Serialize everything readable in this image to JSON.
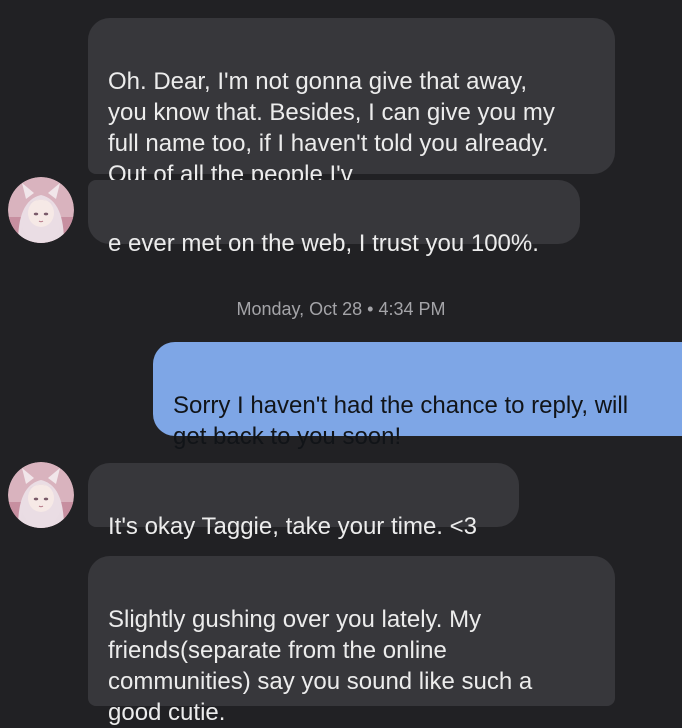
{
  "conversation": {
    "messages": [
      {
        "sender": "contact",
        "text": "Oh. Dear, I'm not gonna give that away,\nyou know that. Besides, I can give you my\nfull name too, if I haven't told you already.\nOut of all the people I'v"
      },
      {
        "sender": "contact",
        "text": "e ever met on the web, I trust you 100%."
      },
      {
        "sender": "me",
        "text": "Sorry I haven't had the chance to reply, will\nget back to you soon!"
      },
      {
        "sender": "contact",
        "text": "It's okay Taggie, take your time. <3"
      },
      {
        "sender": "contact",
        "text": "Slightly gushing over you lately.  My\nfriends(separate from the online\ncommunities) say you sound like such a\ngood cutie."
      }
    ],
    "date_separator": "Monday, Oct 28 • 4:34 PM"
  },
  "colors": {
    "background": "#212124",
    "incoming_bubble": "#37373b",
    "outgoing_bubble": "#7ea6e6",
    "timestamp_text": "#a4a4a8"
  },
  "icons": {
    "contact_avatar": "anime-character-avatar"
  }
}
